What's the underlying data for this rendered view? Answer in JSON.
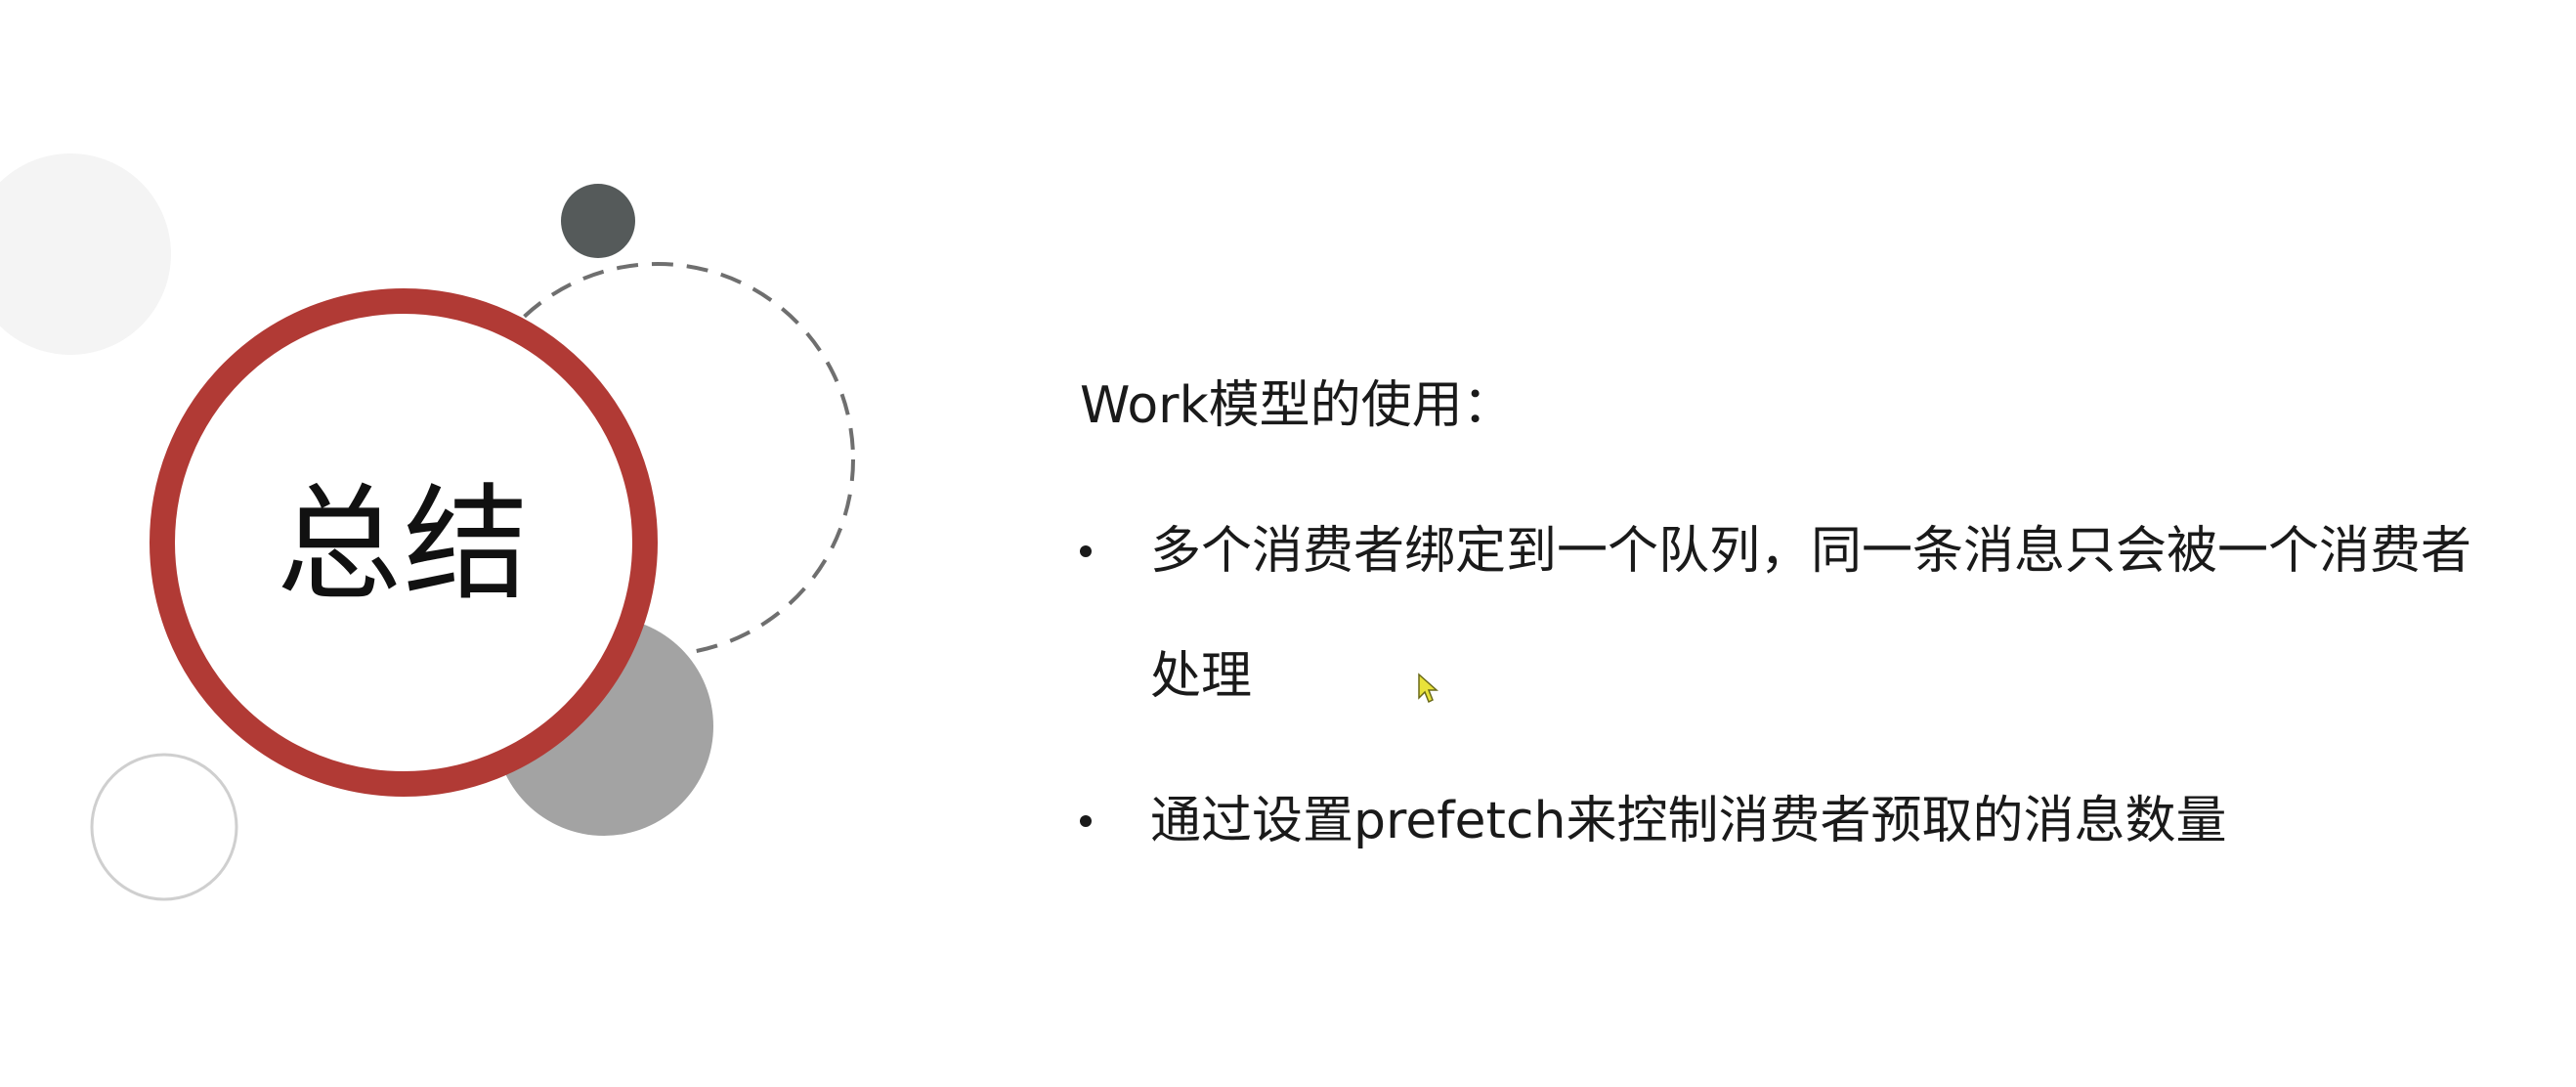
{
  "slide": {
    "title": "总结",
    "heading": "Work模型的使用：",
    "bullets": [
      "多个消费者绑定到一个队列，同一条消息只会被一个消费者处理",
      "通过设置prefetch来控制消费者预取的消息数量"
    ]
  },
  "colors": {
    "accent_ring": "#b13a35",
    "dark_dot": "#555a5a",
    "gray_circle": "#a3a3a3",
    "light_circle": "#f4f4f4",
    "outline_circle": "#cfcfcf",
    "dashed_circle": "#6f6f6f"
  },
  "icons": {
    "cursor": "mouse-pointer-icon"
  }
}
